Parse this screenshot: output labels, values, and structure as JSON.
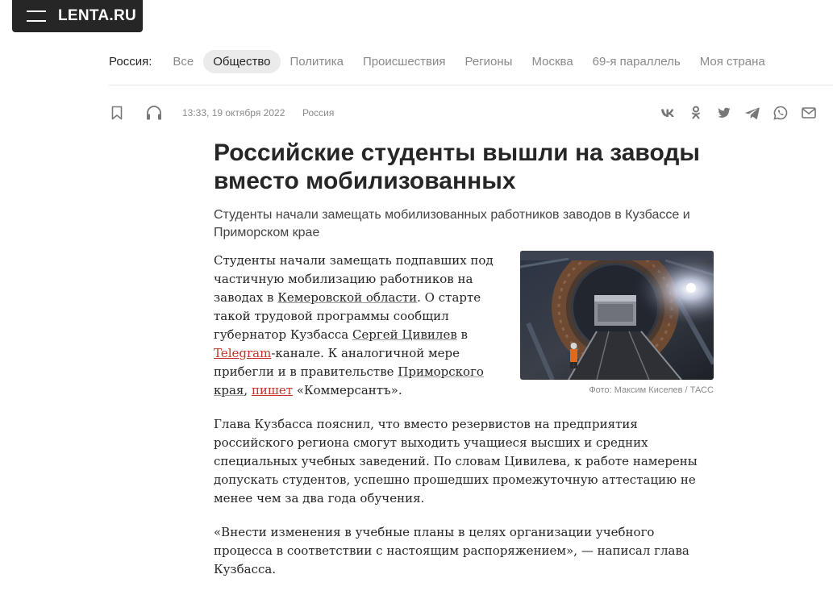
{
  "header": {
    "logo": "LENTA.RU"
  },
  "rubrics": {
    "label": "Россия:",
    "items": [
      "Все",
      "Общество",
      "Политика",
      "Происшествия",
      "Регионы",
      "Москва",
      "69-я параллель",
      "Моя страна"
    ],
    "active": "Общество"
  },
  "meta": {
    "datetime": "13:33, 19 октября 2022",
    "rubric": "Россия"
  },
  "share": [
    "vk-icon",
    "odnoklassniki-icon",
    "twitter-icon",
    "telegram-icon",
    "whatsapp-icon",
    "mail-icon"
  ],
  "article": {
    "title": "Российские студенты вышли на заводы вместо мобилизованных",
    "lead": "Студенты начали замещать мобилизованных работников заводов в Кузбассе и Приморском крае",
    "p1": {
      "t1": "Студенты начали замещать подпавших под частичную мобилизацию работников на заводах в ",
      "l1": "Кемеровской области",
      "t2": ". О старте такой трудовой программы сообщил губернатор Кузбасса ",
      "l2": "Сергей Цивилев",
      "t3": " в ",
      "l3": "Telegram",
      "t4": "-канале. К аналогичной мере прибегли и в правительстве ",
      "l4": "Приморского края",
      "t5": ", ",
      "l5": "пишет",
      "t6": " «Коммерсантъ»."
    },
    "p2": "Глава Кузбасса пояснил, что вместо резервистов на предприятия российского региона смогут выходить учащиеся высших и средних специальных учебных заведений. По словам Цивилева, к работе намерены допускать студентов, успешно прошедших промежуточную аттестацию не менее чем за два года обучения.",
    "p3": "«Внести изменения в учебные планы в целях организации учебного процесса в соответствии с настоящим распоряжением», — написал глава Кузбасса.",
    "photo_caption": "Фото: Максим Киселев / ТАСС"
  },
  "colors": {
    "topbar": "#262626",
    "link_red": "#c63329",
    "muted": "#8a8a8a"
  }
}
